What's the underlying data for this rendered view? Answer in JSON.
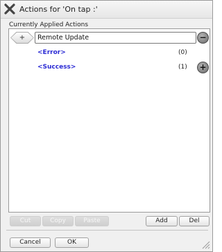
{
  "window": {
    "title": "Actions for 'On tap :'",
    "close_icon": "close-x-icon"
  },
  "section_label": "Currently Applied Actions",
  "action": {
    "expand_symbol": "+",
    "name": "Remote Update",
    "remove_symbol": "−"
  },
  "branches": [
    {
      "label": "<Error>",
      "count": "(0)"
    },
    {
      "label": "<Success>",
      "count": "(1)",
      "add_symbol": "+"
    }
  ],
  "toolbar": {
    "cut": "Cut",
    "copy": "Copy",
    "paste": "Paste",
    "add": "Add",
    "del": "Del"
  },
  "footer": {
    "cancel": "Cancel",
    "ok": "OK"
  }
}
